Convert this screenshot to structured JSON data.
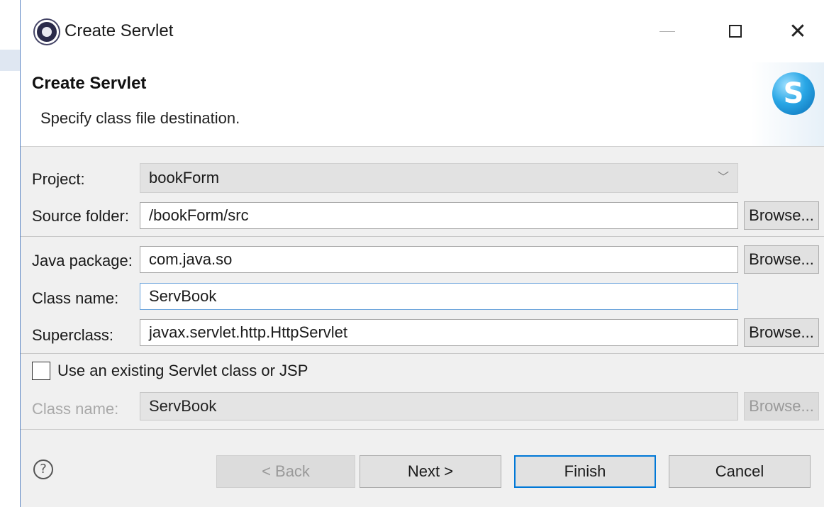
{
  "window": {
    "title": "Create Servlet",
    "app_icon": "eclipse-icon"
  },
  "header": {
    "title": "Create Servlet",
    "description": "Specify class file destination.",
    "icon": "servlet-wizard-icon"
  },
  "form": {
    "project_label": "Project:",
    "project_value": "bookForm",
    "source_folder_label": "Source folder:",
    "source_folder_value": "/bookForm/src",
    "java_package_label": "Java package:",
    "java_package_value": "com.java.so",
    "class_name_label": "Class name:",
    "class_name_value": "ServBook",
    "superclass_label": "Superclass:",
    "superclass_value": "javax.servlet.http.HttpServlet",
    "browse_label": "Browse...",
    "use_existing_label": "Use an existing Servlet class or JSP",
    "use_existing_checked": false,
    "existing_class_label": "Class name:",
    "existing_class_value": "ServBook"
  },
  "buttons": {
    "back": "< Back",
    "next": "Next >",
    "finish": "Finish",
    "cancel": "Cancel"
  },
  "colors": {
    "focus_border": "#6ea6dc",
    "default_button_border": "#0078d7",
    "dialog_bg": "#f0f0f0"
  }
}
